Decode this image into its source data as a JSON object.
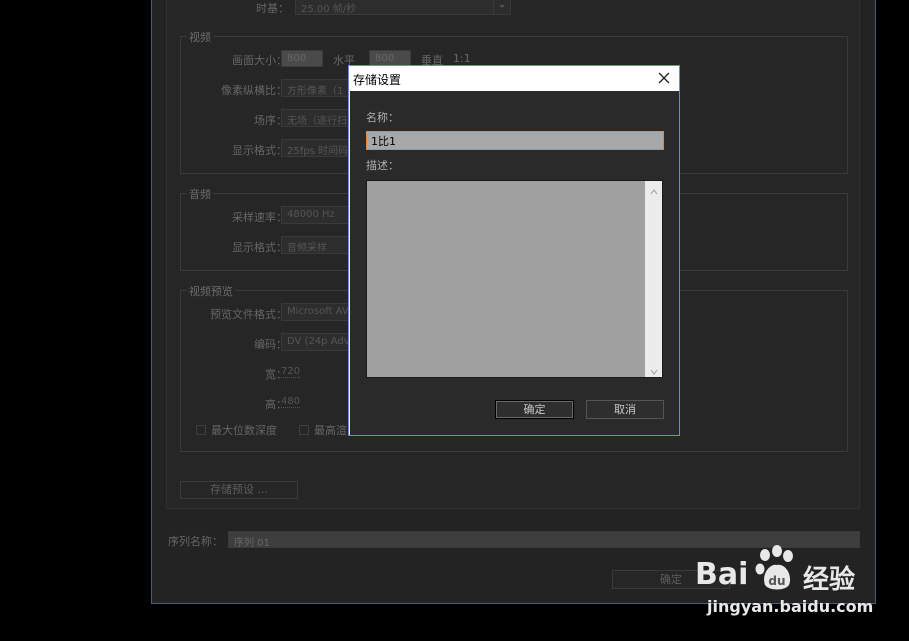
{
  "background_window": {
    "timebase": {
      "label": "时基：",
      "value": "25.00 帧/秒"
    },
    "video": {
      "group_title": "视频",
      "frame_size": {
        "label": "画面大小：",
        "value": "800",
        "horizontal_label": "水平",
        "vertical_value": "800",
        "vertical_label": "垂直",
        "ratio": "1:1"
      },
      "pixel_aspect": {
        "label": "像素纵横比：",
        "value": "方形像素（1"
      },
      "field_order": {
        "label": "场序：",
        "value": "无场（逐行扫"
      },
      "display_format": {
        "label": "显示格式：",
        "value": "25fps 时间码"
      }
    },
    "audio": {
      "group_title": "音频",
      "sample_rate": {
        "label": "采样速率：",
        "value": "48000 Hz"
      },
      "display_format": {
        "label": "显示格式：",
        "value": "音频采样"
      }
    },
    "video_preview": {
      "group_title": "视频预览",
      "file_format": {
        "label": "预览文件格式：",
        "value": "Microsoft AV"
      },
      "codec": {
        "label": "编码：",
        "value": "DV (24p Adv"
      },
      "width": {
        "label": "宽：",
        "value": "720"
      },
      "height": {
        "label": "高：",
        "value": "480"
      },
      "max_bit_depth": "最大位数深度",
      "max_quality": "最高渲"
    },
    "save_preset_button": "存储预设 ...",
    "sequence_name": {
      "label": "序列名称：",
      "value": "序列 01"
    },
    "ok_button": "确定"
  },
  "dialog": {
    "title": "存储设置",
    "name_label": "名称：",
    "name_value": "1比1",
    "description_label": "描述：",
    "description_value": "",
    "ok_button": "确定",
    "cancel_button": "取消"
  },
  "watermark": {
    "brand_cn": "经验",
    "brand_prefix": "Bai",
    "url": "jingyan.baidu.com"
  },
  "icons": [
    "close-icon",
    "dropdown-arrow-icon",
    "scroll-up-icon",
    "scroll-down-icon",
    "baidu-paw-icon"
  ],
  "colors": {
    "dialog_border": "#6a8cc8",
    "name_focus_border": "#d98a4a"
  }
}
